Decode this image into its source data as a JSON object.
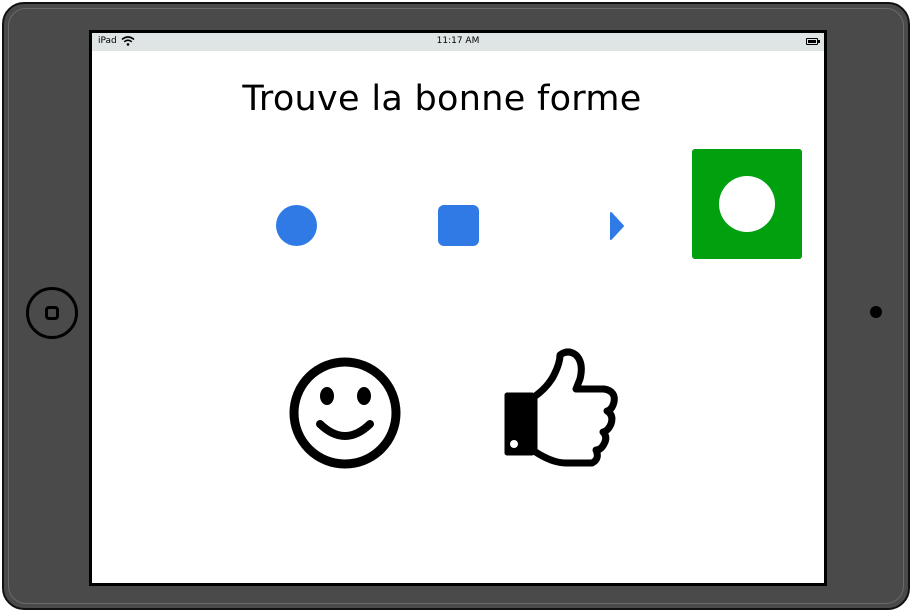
{
  "status_bar": {
    "device": "iPad",
    "time": "11:17 AM",
    "wifi_icon": "wifi-icon",
    "battery_icon": "battery-icon"
  },
  "title": "Trouve la bonne forme",
  "colors": {
    "shape_blue": "#2f7ae5",
    "answer_green": "#00a00e",
    "device_gray": "#4a4a4a",
    "status_bar_bg": "#dfe5e5"
  },
  "choices": [
    {
      "shape": "circle",
      "icon": "circle-shape-icon"
    },
    {
      "shape": "square",
      "icon": "square-shape-icon"
    },
    {
      "shape": "triangle",
      "icon": "triangle-shape-icon"
    }
  ],
  "target": {
    "shape": "circle",
    "icon": "circle-target-icon"
  },
  "feedback": {
    "smiley_icon": "smiley-face-icon",
    "thumb_icon": "thumbs-up-icon"
  }
}
